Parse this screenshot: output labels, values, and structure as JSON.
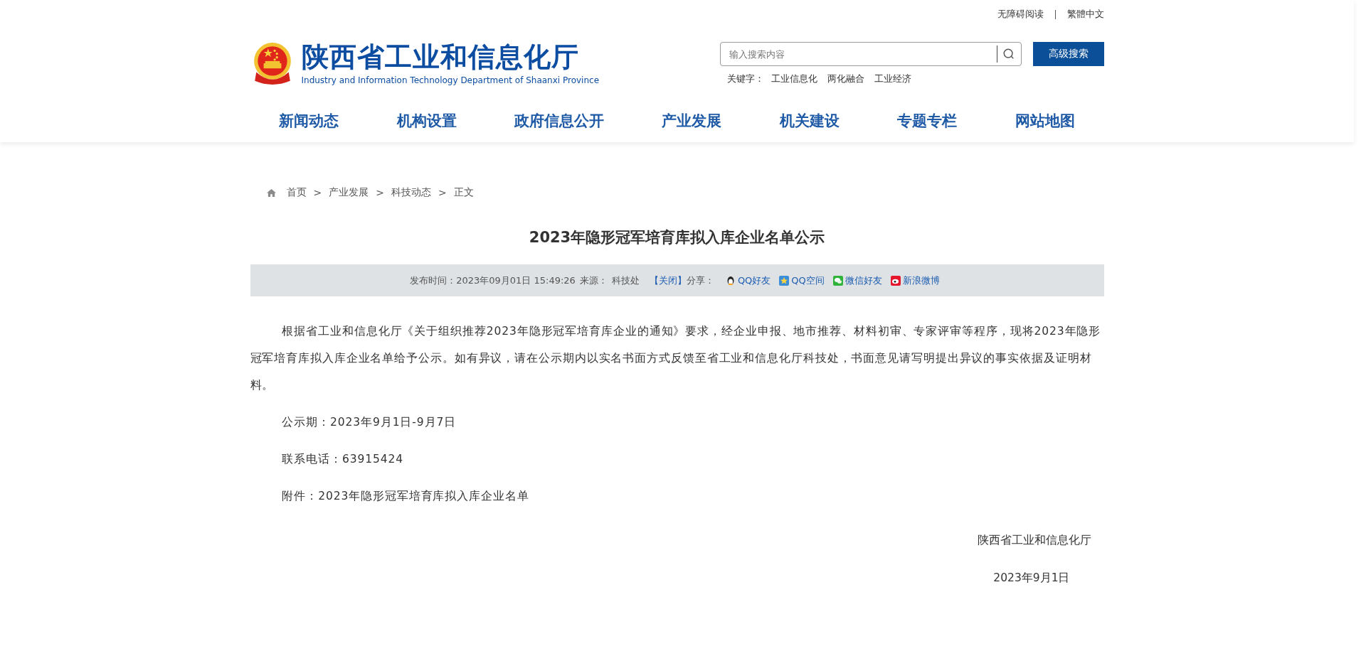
{
  "top_links": [
    "无障碍阅读",
    "繁體中文"
  ],
  "logo": {
    "title": "陕西省工业和信息化厅",
    "subtitle": "Industry and Information Technology Department of Shaanxi Province"
  },
  "search": {
    "placeholder": "输入搜索内容",
    "advanced_button": "高级搜索"
  },
  "keywords": {
    "label": "关键字：",
    "items": [
      "工业信息化",
      "两化融合",
      "工业经济"
    ]
  },
  "nav": [
    "新闻动态",
    "机构设置",
    "政府信息公开",
    "产业发展",
    "机关建设",
    "专题专栏",
    "网站地图"
  ],
  "breadcrumb": [
    "首页",
    "产业发展",
    "科技动态",
    "正文"
  ],
  "breadcrumb_separator": ">",
  "article": {
    "title": "2023年隐形冠军培育库拟入库企业名单公示",
    "meta": {
      "published": "发布时间：2023年09月01日 15:49:26",
      "source_label": "来源：",
      "source": "科技处",
      "close": "【关闭】",
      "share_label": "分享：",
      "share": [
        {
          "kind": "qq",
          "label": "QQ好友"
        },
        {
          "kind": "qzone",
          "label": "QQ空间"
        },
        {
          "kind": "wechat",
          "label": "微信好友"
        },
        {
          "kind": "weibo",
          "label": "新浪微博"
        }
      ]
    },
    "body": [
      "根据省工业和信息化厅《关于组织推荐2023年隐形冠军培育库企业的通知》要求，经企业申报、地市推荐、材料初审、专家评审等程序，现将2023年隐形冠军培育库拟入库企业名单给予公示。如有异议，请在公示期内以实名书面方式反馈至省工业和信息化厅科技处，书面意见请写明提出异议的事实依据及证明材料。",
      "公示期：2023年9月1日-9月7日",
      "联系电话：63915424",
      "附件：2023年隐形冠军培育库拟入库企业名单"
    ],
    "signature": [
      "陕西省工业和信息化厅",
      "2023年9月1日"
    ]
  }
}
